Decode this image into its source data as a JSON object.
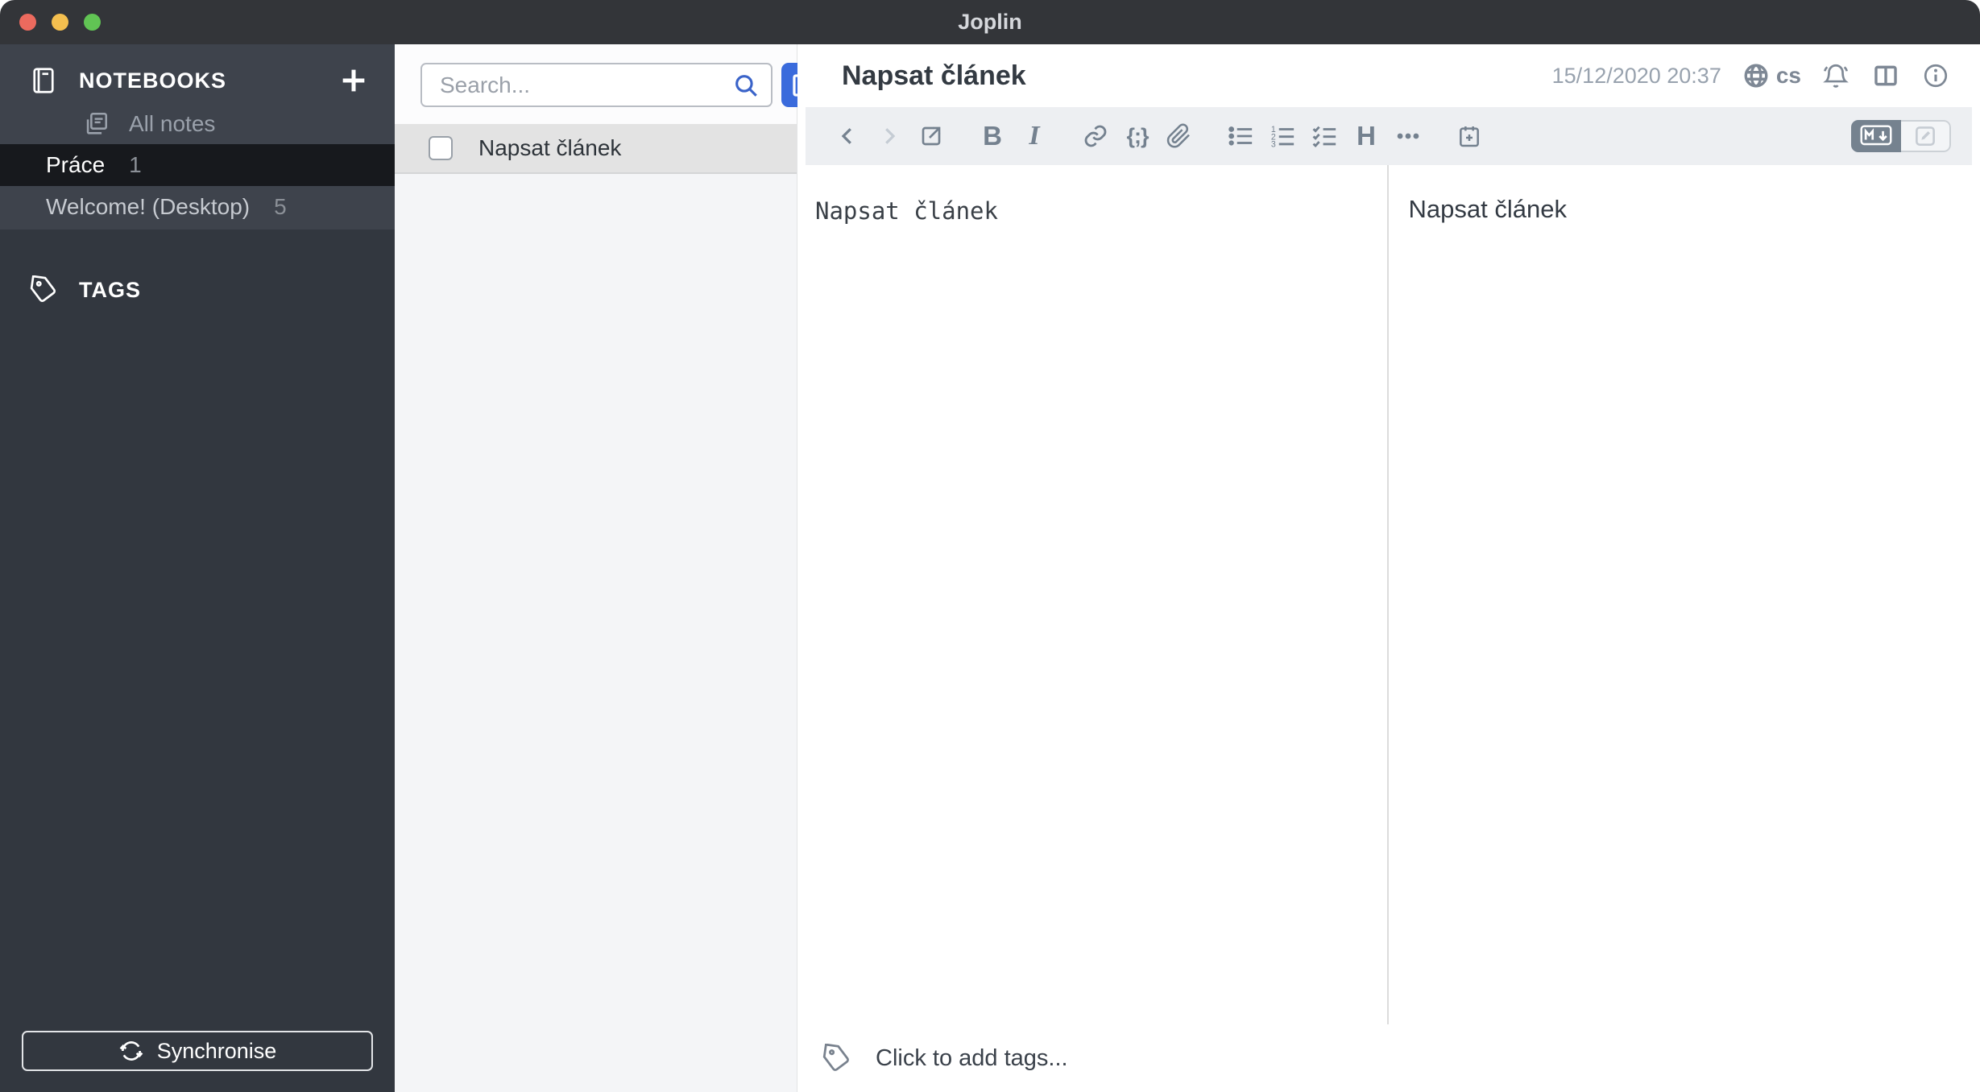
{
  "window": {
    "title": "Joplin"
  },
  "sidebar": {
    "notebooks_header": "NOTEBOOKS",
    "all_notes_label": "All notes",
    "items": [
      {
        "label": "Práce",
        "count": "1",
        "selected": true
      },
      {
        "label": "Welcome! (Desktop)",
        "count": "5",
        "selected": false
      }
    ],
    "tags_header": "TAGS",
    "sync_label": "Synchronise"
  },
  "note_list": {
    "search_placeholder": "Search...",
    "items": [
      {
        "title": "Napsat článek",
        "checked": false
      }
    ]
  },
  "editor": {
    "title": "Napsat článek",
    "date": "15/12/2020 20:37",
    "locale": "cs",
    "toolbar": {
      "bold": "B",
      "italic": "I",
      "code": "{;}",
      "heading": "H"
    },
    "markdown_text": "Napsat článek",
    "preview_text": "Napsat článek",
    "tags_placeholder": "Click to add tags..."
  },
  "colors": {
    "accent_blue": "#3a6bdc",
    "titlebar": "#333539",
    "sidebar_bg": "#32373f",
    "sidebar_section_bg": "#3e434c",
    "sidebar_selected_bg": "#17191d",
    "traffic_red": "#ec6a5e",
    "traffic_yellow": "#f4bf4f",
    "traffic_green": "#61c454",
    "toolbar_bg": "#edeff2",
    "list_selected_bg": "#e3e3e3"
  }
}
